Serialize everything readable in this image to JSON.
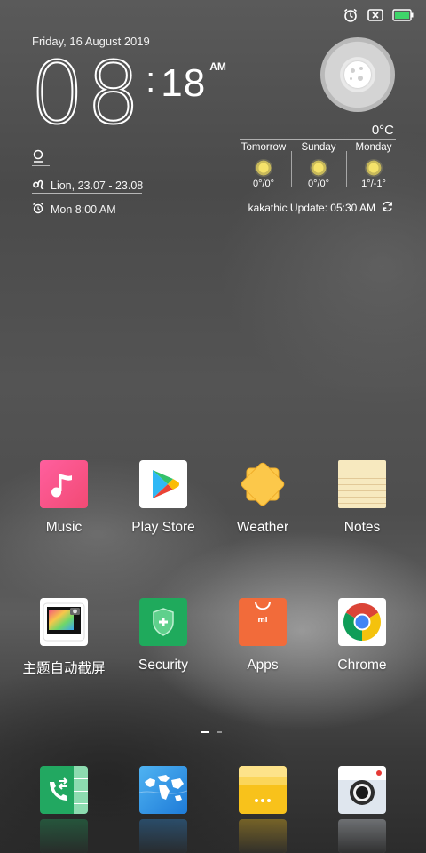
{
  "status_bar": {
    "icons": [
      "alarm-icon",
      "no-sim-icon",
      "battery-icon"
    ],
    "battery_color": "#3fd56a"
  },
  "clock_widget": {
    "date": "Friday, 16 August 2019",
    "hours": "08",
    "colon": ":",
    "minutes": "18",
    "ampm": "AM",
    "zodiac": "Lion, 23.07 - 23.08",
    "alarm": "Mon 8:00 AM"
  },
  "weather_widget": {
    "current_temp": "0°C",
    "forecast": [
      {
        "day": "Tomorrow",
        "temp": "0°/0°"
      },
      {
        "day": "Sunday",
        "temp": "0°/0°"
      },
      {
        "day": "Monday",
        "temp": "1°/-1°"
      }
    ],
    "update_text": "kakathic Update: 05:30 AM"
  },
  "apps": {
    "row1": [
      {
        "label": "Music",
        "icon": "music-note-icon"
      },
      {
        "label": "Play Store",
        "icon": "play-store-icon"
      },
      {
        "label": "Weather",
        "icon": "sun-icon"
      },
      {
        "label": "Notes",
        "icon": "notepad-icon"
      }
    ],
    "row2": [
      {
        "label": "主题自动截屏",
        "icon": "screenshot-photo-icon"
      },
      {
        "label": "Security",
        "icon": "shield-icon"
      },
      {
        "label": "Apps",
        "icon": "shopping-bag-icon"
      },
      {
        "label": "Chrome",
        "icon": "chrome-icon"
      }
    ]
  },
  "page_indicator": {
    "pages": 2,
    "current": 1
  },
  "dock": [
    {
      "icon": "phone-icon",
      "color": "#22a861"
    },
    {
      "icon": "browser-globe-icon",
      "color": "#2f8fe0"
    },
    {
      "icon": "file-manager-icon",
      "color": "#f8c21b"
    },
    {
      "icon": "camera-icon",
      "color": "#dfe6ee"
    }
  ],
  "colors": {
    "music": "#f24a74",
    "security": "#1faa5c",
    "apps": "#f26b3a",
    "weather_sun": "#fcc84a"
  }
}
